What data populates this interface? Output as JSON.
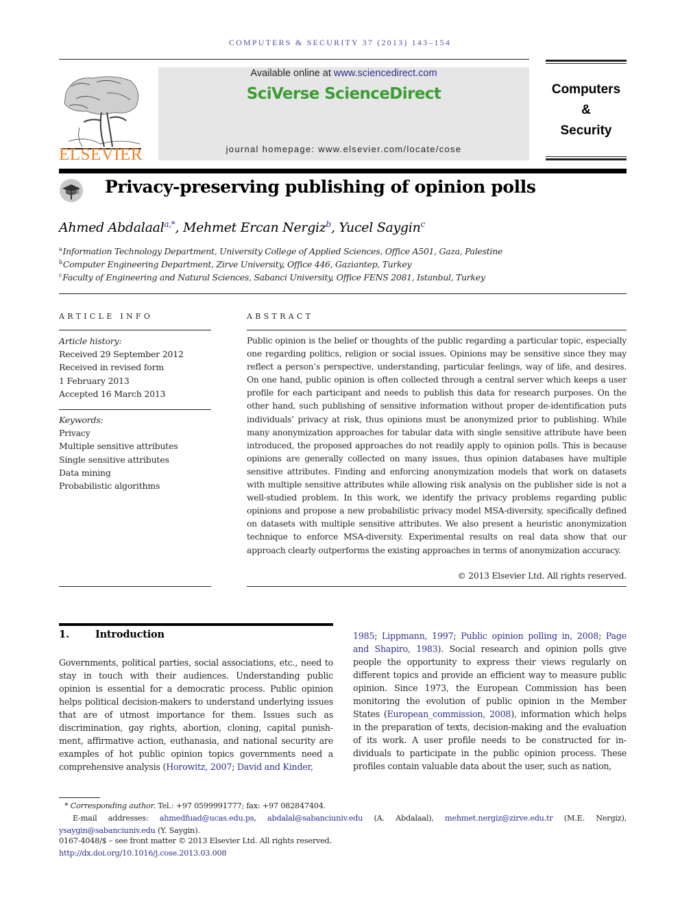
{
  "running_head": "COMPUTERS & SECURITY 37 (2013) 143–154",
  "masthead": {
    "publisher_logo": "ELSEVIER",
    "available_online_prefix": "Available online at ",
    "available_online_link": "www.sciencedirect.com",
    "brand": "SciVerse ScienceDirect",
    "homepage": "journal homepage: www.elsevier.com/locate/cose",
    "journal_name_line1": "Computers",
    "journal_name_line2": "&",
    "journal_name_line3": "Security"
  },
  "colors": {
    "elsevier_orange": "#f47f20",
    "sciencedirect_green": "#3d9b35",
    "link_blue": "#2b2e8c",
    "masthead_gray": "#e6e6e6"
  },
  "article": {
    "crossmark_icon": "crossmark-icon",
    "title": "Privacy-preserving publishing of opinion polls",
    "authors": [
      {
        "name": "Ahmed Abdalaal",
        "sup": "a,*",
        "sep": ", "
      },
      {
        "name": "Mehmet Ercan Nergiz",
        "sup": "b",
        "sep": ", "
      },
      {
        "name": "Yucel Saygin",
        "sup": "c",
        "sep": ""
      }
    ],
    "affiliations": [
      {
        "mark": "a",
        "text": "Information Technology Department, University College of Applied Sciences, Office A501, Gaza, Palestine"
      },
      {
        "mark": "b",
        "text": "Computer Engineering Department, Zirve University, Office 446, Gaziantep, Turkey"
      },
      {
        "mark": "c",
        "text": "Faculty of Engineering and Natural Sciences, Sabanci University, Office FENS 2081, Istanbul, Turkey"
      }
    ]
  },
  "article_info": {
    "heading": "ARTICLE INFO",
    "history_label": "Article history:",
    "history": [
      "Received 29 September 2012",
      "Received in revised form",
      "1 February 2013",
      "Accepted 16 March 2013"
    ],
    "keywords_label": "Keywords:",
    "keywords": [
      "Privacy",
      "Multiple sensitive attributes",
      "Single sensitive attributes",
      "Data mining",
      "Probabilistic algorithms"
    ]
  },
  "abstract": {
    "heading": "ABSTRACT",
    "text": "Public opinion is the belief or thoughts of the public regarding a particular topic, especially one regarding politics, religion or social issues. Opinions may be sensitive since they may reflect a person’s perspective, understanding, particular feelings, way of life, and desires. On one hand, public opinion is often collected through a central server which keeps a user profile for each participant and needs to publish this data for research purposes. On the other hand, such publishing of sensitive information without proper de-identification puts individuals’ privacy at risk, thus opinions must be anonymized prior to publishing. While many anonymization approaches for tabular data with single sensitive attribute have been introduced, the proposed approaches do not readily apply to opinion polls. This is because opinions are generally collected on many issues, thus opinion databases have multiple sensitive attributes. Finding and enforcing anonymization models that work on datasets with multiple sensitive attributes while allowing risk analysis on the publisher side is not a well-studied problem. In this work, we identify the privacy problems regarding public opinions and propose a new probabilistic privacy model MSA-diversity, specifically defined on datasets with multiple sensitive attributes. We also present a heuristic anonymization technique to enforce MSA-diversity. Experimental results on real data show that our approach clearly outperforms the existing approaches in terms of anonymization accuracy.",
    "copyright": "© 2013 Elsevier Ltd. All rights reserved."
  },
  "introduction": {
    "number": "1.",
    "title": "Introduction",
    "left_text": "Governments, political parties, social associations, etc., need to stay in touch with their audiences. Understanding public opinion is essential for a democratic process. Public opinion helps political decision-makers to understand underlying is­sues that are of utmost importance for them. Issues such as discrimination, gay rights, abortion, cloning, capital punish­ment, affirmative action, euthanasia, and national security are examples of hot public opinion topics governments need a comprehensive analysis (",
    "cite_horowitz": "Horowitz, 2007",
    "cite_sep1": "; ",
    "cite_david_kinder_a": "David and Kinder,",
    "cite_david_kinder_b": "1985",
    "cite_sep2": "; ",
    "cite_lippmann": "Lippmann, 1997",
    "cite_sep3": "; ",
    "cite_polling": "Public opinion polling in, 2008",
    "cite_sep4": "; ",
    "cite_page_shapiro": "Page and Shapiro, 1983",
    "right_text_1": "). Social research and opinion polls give people the opportunity to express their views regularly on different topics and provide an efficient way to measure public opinion. Since 1973, the European Commission has been monitoring the evolution of public opinion in the Member States (",
    "cite_ec": "European_commission, 2008",
    "right_text_2": "), information which helps in the preparation of texts, decision-making and the evalua­tion of its work. A user profile needs to be constructed for in­dividuals to participate in the public opinion process. These profiles contain valuable data about the user, such as nation,"
  },
  "footnotes": {
    "corresponding_mark": "*",
    "corresponding_label": "Corresponding author.",
    "contact": " Tel.: +97 0599991777; fax: +97 082847404.",
    "email_label": "E-mail addresses: ",
    "emails": [
      {
        "address": "ahmedfuad@ucas.edu.ps",
        "after": ", "
      },
      {
        "address": "abdalal@sabanciuniv.edu",
        "after": " (A. Abdalaal), "
      },
      {
        "address": "mehmet.nergiz@zirve.edu.tr",
        "after": " (M.E. Nergiz), "
      },
      {
        "address": "ysaygin@sabanciuniv.edu",
        "after": " (Y. Saygin)."
      }
    ],
    "issn_line": "0167-4048/$ – see front matter © 2013 Elsevier Ltd. All rights reserved.",
    "doi": "http://dx.doi.org/10.1016/j.cose.2013.03.008"
  }
}
